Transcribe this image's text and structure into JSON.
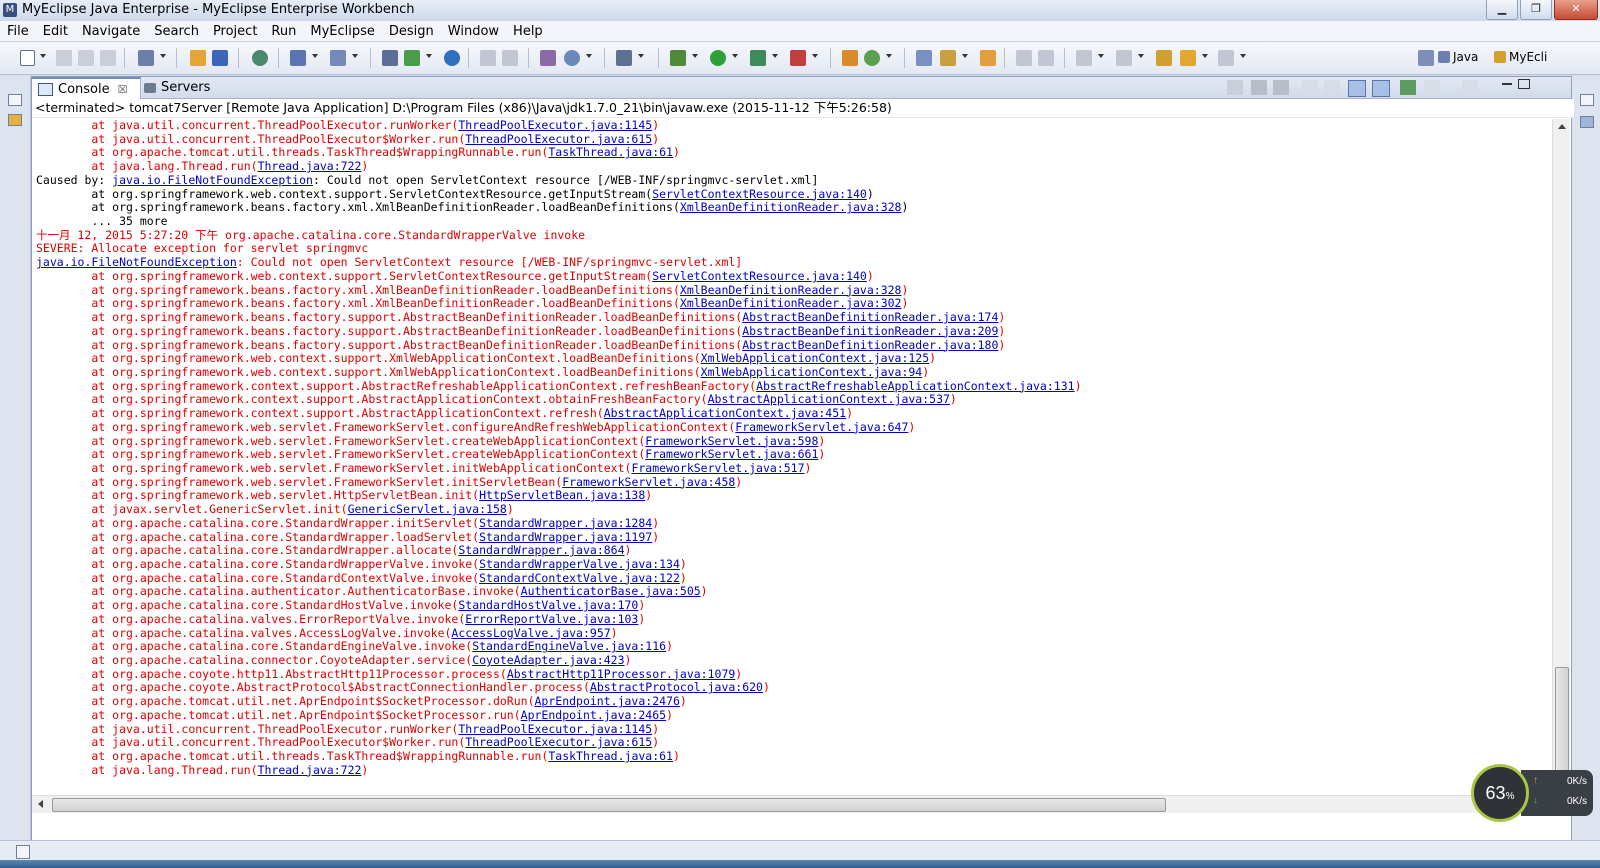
{
  "window": {
    "title": "MyEclipse Java Enterprise - MyEclipse Enterprise Workbench"
  },
  "menu": [
    "File",
    "Edit",
    "Navigate",
    "Search",
    "Project",
    "Run",
    "MyEclipse",
    "Design",
    "Window",
    "Help"
  ],
  "perspectives": {
    "java": "Java",
    "myeclipse": "MyEcli"
  },
  "tabs": {
    "console": "Console",
    "servers": "Servers",
    "close_glyph": "☒"
  },
  "console": {
    "status": "<terminated> tomcat7Server [Remote Java Application] D:\\Program Files (x86)\\Java\\jdk1.7.0_21\\bin\\javaw.exe (2015-11-12 下午5:26:58)",
    "lines": [
      {
        "c": "err",
        "t": "        at java.util.concurrent.ThreadPoolExecutor.runWorker(",
        "l": "ThreadPoolExecutor.java:1145",
        "s": ")"
      },
      {
        "c": "err",
        "t": "        at java.util.concurrent.ThreadPoolExecutor$Worker.run(",
        "l": "ThreadPoolExecutor.java:615",
        "s": ")"
      },
      {
        "c": "err",
        "t": "        at org.apache.tomcat.util.threads.TaskThread$WrappingRunnable.run(",
        "l": "TaskThread.java:61",
        "s": ")"
      },
      {
        "c": "err",
        "t": "        at java.lang.Thread.run(",
        "l": "Thread.java:722",
        "s": ")"
      },
      {
        "c": "blk",
        "t": "Caused by: ",
        "l": "java.io.FileNotFoundException",
        "s": ": Could not open ServletContext resource [/WEB-INF/springmvc-servlet.xml]"
      },
      {
        "c": "blk",
        "t": "        at org.springframework.web.context.support.ServletContextResource.getInputStream(",
        "l": "ServletContextResource.java:140",
        "s": ")"
      },
      {
        "c": "blk",
        "t": "        at org.springframework.beans.factory.xml.XmlBeanDefinitionReader.loadBeanDefinitions(",
        "l": "XmlBeanDefinitionReader.java:328",
        "s": ")"
      },
      {
        "c": "blk",
        "t": "        ... 35 more",
        "l": "",
        "s": ""
      },
      {
        "c": "err",
        "t": "十一月 12, 2015 5:27:20 下午 org.apache.catalina.core.StandardWrapperValve invoke",
        "l": "",
        "s": ""
      },
      {
        "c": "err",
        "t": "SEVERE: Allocate exception for servlet springmvc",
        "l": "",
        "s": ""
      },
      {
        "c": "err",
        "t": "",
        "l": "java.io.FileNotFoundException",
        "s": ": Could not open ServletContext resource [/WEB-INF/springmvc-servlet.xml]"
      },
      {
        "c": "err",
        "t": "        at org.springframework.web.context.support.ServletContextResource.getInputStream(",
        "l": "ServletContextResource.java:140",
        "s": ")"
      },
      {
        "c": "err",
        "t": "        at org.springframework.beans.factory.xml.XmlBeanDefinitionReader.loadBeanDefinitions(",
        "l": "XmlBeanDefinitionReader.java:328",
        "s": ")"
      },
      {
        "c": "err",
        "t": "        at org.springframework.beans.factory.xml.XmlBeanDefinitionReader.loadBeanDefinitions(",
        "l": "XmlBeanDefinitionReader.java:302",
        "s": ")"
      },
      {
        "c": "err",
        "t": "        at org.springframework.beans.factory.support.AbstractBeanDefinitionReader.loadBeanDefinitions(",
        "l": "AbstractBeanDefinitionReader.java:174",
        "s": ")"
      },
      {
        "c": "err",
        "t": "        at org.springframework.beans.factory.support.AbstractBeanDefinitionReader.loadBeanDefinitions(",
        "l": "AbstractBeanDefinitionReader.java:209",
        "s": ")"
      },
      {
        "c": "err",
        "t": "        at org.springframework.beans.factory.support.AbstractBeanDefinitionReader.loadBeanDefinitions(",
        "l": "AbstractBeanDefinitionReader.java:180",
        "s": ")"
      },
      {
        "c": "err",
        "t": "        at org.springframework.web.context.support.XmlWebApplicationContext.loadBeanDefinitions(",
        "l": "XmlWebApplicationContext.java:125",
        "s": ")"
      },
      {
        "c": "err",
        "t": "        at org.springframework.web.context.support.XmlWebApplicationContext.loadBeanDefinitions(",
        "l": "XmlWebApplicationContext.java:94",
        "s": ")"
      },
      {
        "c": "err",
        "t": "        at org.springframework.context.support.AbstractRefreshableApplicationContext.refreshBeanFactory(",
        "l": "AbstractRefreshableApplicationContext.java:131",
        "s": ")"
      },
      {
        "c": "err",
        "t": "        at org.springframework.context.support.AbstractApplicationContext.obtainFreshBeanFactory(",
        "l": "AbstractApplicationContext.java:537",
        "s": ")"
      },
      {
        "c": "err",
        "t": "        at org.springframework.context.support.AbstractApplicationContext.refresh(",
        "l": "AbstractApplicationContext.java:451",
        "s": ")"
      },
      {
        "c": "err",
        "t": "        at org.springframework.web.servlet.FrameworkServlet.configureAndRefreshWebApplicationContext(",
        "l": "FrameworkServlet.java:647",
        "s": ")"
      },
      {
        "c": "err",
        "t": "        at org.springframework.web.servlet.FrameworkServlet.createWebApplicationContext(",
        "l": "FrameworkServlet.java:598",
        "s": ")"
      },
      {
        "c": "err",
        "t": "        at org.springframework.web.servlet.FrameworkServlet.createWebApplicationContext(",
        "l": "FrameworkServlet.java:661",
        "s": ")"
      },
      {
        "c": "err",
        "t": "        at org.springframework.web.servlet.FrameworkServlet.initWebApplicationContext(",
        "l": "FrameworkServlet.java:517",
        "s": ")"
      },
      {
        "c": "err",
        "t": "        at org.springframework.web.servlet.FrameworkServlet.initServletBean(",
        "l": "FrameworkServlet.java:458",
        "s": ")"
      },
      {
        "c": "err",
        "t": "        at org.springframework.web.servlet.HttpServletBean.init(",
        "l": "HttpServletBean.java:138",
        "s": ")"
      },
      {
        "c": "err",
        "t": "        at javax.servlet.GenericServlet.init(",
        "l": "GenericServlet.java:158",
        "s": ")"
      },
      {
        "c": "err",
        "t": "        at org.apache.catalina.core.StandardWrapper.initServlet(",
        "l": "StandardWrapper.java:1284",
        "s": ")"
      },
      {
        "c": "err",
        "t": "        at org.apache.catalina.core.StandardWrapper.loadServlet(",
        "l": "StandardWrapper.java:1197",
        "s": ")"
      },
      {
        "c": "err",
        "t": "        at org.apache.catalina.core.StandardWrapper.allocate(",
        "l": "StandardWrapper.java:864",
        "s": ")"
      },
      {
        "c": "err",
        "t": "        at org.apache.catalina.core.StandardWrapperValve.invoke(",
        "l": "StandardWrapperValve.java:134",
        "s": ")"
      },
      {
        "c": "err",
        "t": "        at org.apache.catalina.core.StandardContextValve.invoke(",
        "l": "StandardContextValve.java:122",
        "s": ")"
      },
      {
        "c": "err",
        "t": "        at org.apache.catalina.authenticator.AuthenticatorBase.invoke(",
        "l": "AuthenticatorBase.java:505",
        "s": ")"
      },
      {
        "c": "err",
        "t": "        at org.apache.catalina.core.StandardHostValve.invoke(",
        "l": "StandardHostValve.java:170",
        "s": ")"
      },
      {
        "c": "err",
        "t": "        at org.apache.catalina.valves.ErrorReportValve.invoke(",
        "l": "ErrorReportValve.java:103",
        "s": ")"
      },
      {
        "c": "err",
        "t": "        at org.apache.catalina.valves.AccessLogValve.invoke(",
        "l": "AccessLogValve.java:957",
        "s": ")"
      },
      {
        "c": "err",
        "t": "        at org.apache.catalina.core.StandardEngineValve.invoke(",
        "l": "StandardEngineValve.java:116",
        "s": ")"
      },
      {
        "c": "err",
        "t": "        at org.apache.catalina.connector.CoyoteAdapter.service(",
        "l": "CoyoteAdapter.java:423",
        "s": ")"
      },
      {
        "c": "err",
        "t": "        at org.apache.coyote.http11.AbstractHttp11Processor.process(",
        "l": "AbstractHttp11Processor.java:1079",
        "s": ")"
      },
      {
        "c": "err",
        "t": "        at org.apache.coyote.AbstractProtocol$AbstractConnectionHandler.process(",
        "l": "AbstractProtocol.java:620",
        "s": ")"
      },
      {
        "c": "err",
        "t": "        at org.apache.tomcat.util.net.AprEndpoint$SocketProcessor.doRun(",
        "l": "AprEndpoint.java:2476",
        "s": ")"
      },
      {
        "c": "err",
        "t": "        at org.apache.tomcat.util.net.AprEndpoint$SocketProcessor.run(",
        "l": "AprEndpoint.java:2465",
        "s": ")"
      },
      {
        "c": "err",
        "t": "        at java.util.concurrent.ThreadPoolExecutor.runWorker(",
        "l": "ThreadPoolExecutor.java:1145",
        "s": ")"
      },
      {
        "c": "err",
        "t": "        at java.util.concurrent.ThreadPoolExecutor$Worker.run(",
        "l": "ThreadPoolExecutor.java:615",
        "s": ")"
      },
      {
        "c": "err",
        "t": "        at org.apache.tomcat.util.threads.TaskThread$WrappingRunnable.run(",
        "l": "TaskThread.java:61",
        "s": ")"
      },
      {
        "c": "err",
        "t": "        at java.lang.Thread.run(",
        "l": "Thread.java:722",
        "s": ")"
      }
    ]
  },
  "net_widget": {
    "percent": "63",
    "percent_sign": "%",
    "upload": "0K/s",
    "download": "0K/s",
    "up_arrow": "↑",
    "down_arrow": "↓"
  },
  "window_buttons": {
    "minimize": "▁",
    "restore": "❐",
    "close": "✕"
  },
  "colors": {
    "error_text": "#e00000",
    "link": "#0000c8"
  }
}
